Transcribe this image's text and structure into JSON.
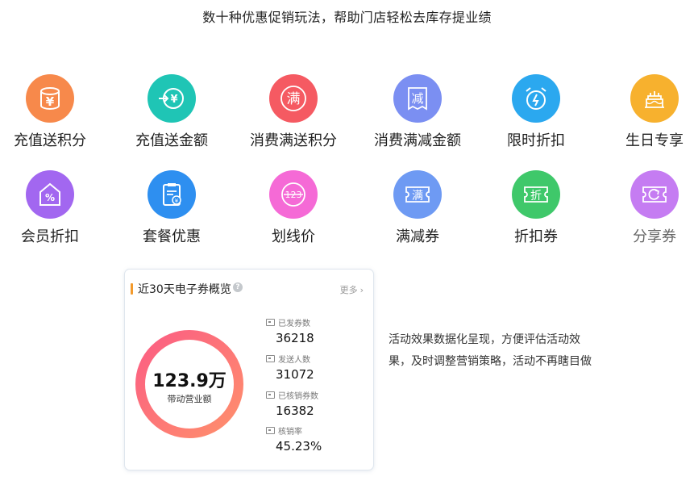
{
  "heading": "数十种优惠促销玩法，帮助门店轻松去库存提业绩",
  "features": [
    {
      "label": "充值送积分",
      "icon": "yen-coins-icon",
      "color": "#f7894b"
    },
    {
      "label": "充值送金额",
      "icon": "transfer-yen-icon",
      "color": "#1fc5b5"
    },
    {
      "label": "消费满送积分",
      "icon": "man-character-icon",
      "color": "#f55a62",
      "glyph": "满"
    },
    {
      "label": "消费满减金额",
      "icon": "reduce-tag-icon",
      "color": "#7b8ff2",
      "glyph": "减"
    },
    {
      "label": "限时折扣",
      "icon": "alarm-clock-icon",
      "color": "#2ba8ef"
    },
    {
      "label": "生日专享",
      "icon": "birthday-cake-icon",
      "color": "#f7b12e"
    },
    {
      "label": "会员折扣",
      "icon": "percent-house-icon",
      "color": "#a267f0"
    },
    {
      "label": "套餐优惠",
      "icon": "clipboard-yen-icon",
      "color": "#2e8ff0"
    },
    {
      "label": "划线价",
      "icon": "strikethrough-price-icon",
      "color": "#f56ad6",
      "glyph": "123"
    },
    {
      "label": "满减券",
      "icon": "man-coupon-icon",
      "color": "#6e9af3",
      "glyph": "满"
    },
    {
      "label": "折扣券",
      "icon": "discount-coupon-icon",
      "color": "#3fc86a",
      "glyph": "折"
    },
    {
      "label": "分享券",
      "icon": "share-coupon-icon",
      "color": "#c57cf2"
    }
  ],
  "card": {
    "title": "近30天电子券概览",
    "more": "更多",
    "ring_value": "123.9万",
    "ring_caption": "带动营业额",
    "stats": [
      {
        "label": "已发券数",
        "value": "36218"
      },
      {
        "label": "发送人数",
        "value": "31072"
      },
      {
        "label": "已核销券数",
        "value": "16382"
      },
      {
        "label": "核销率",
        "value": "45.23%"
      }
    ]
  },
  "description": "活动效果数据化呈现，方便评估活动效果，及时调整营销策略，活动不再瞎目做"
}
